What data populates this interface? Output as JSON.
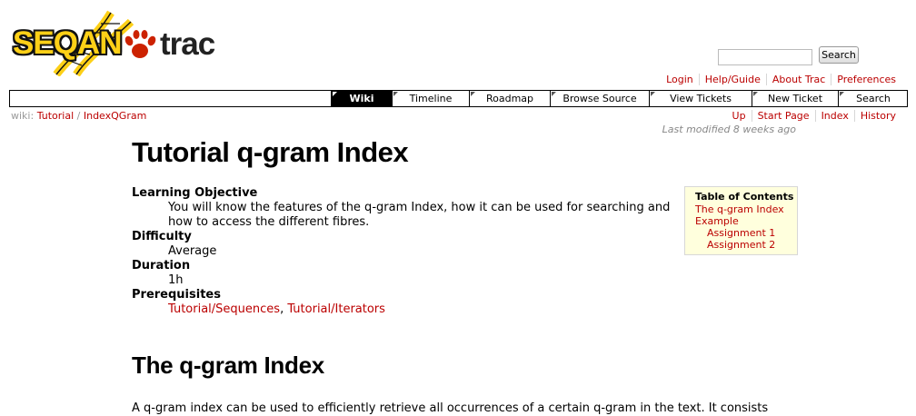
{
  "logo": {
    "seqan_text": "SEQAN",
    "trac_text": "trac"
  },
  "search": {
    "value": "",
    "button_label": "Search"
  },
  "metanav": [
    "Login",
    "Help/Guide",
    "About Trac",
    "Preferences"
  ],
  "mainnav": [
    "Wiki",
    "Timeline",
    "Roadmap",
    "Browse Source",
    "View Tickets",
    "New Ticket",
    "Search"
  ],
  "mainnav_active": "Wiki",
  "breadcrumb": {
    "prefix": "wiki:",
    "items": [
      "Tutorial",
      "IndexQGram"
    ],
    "separator": "/"
  },
  "ctxnav": [
    "Up",
    "Start Page",
    "Index",
    "History"
  ],
  "last_modified": "Last modified 8 weeks ago",
  "page": {
    "title": "Tutorial q-gram Index",
    "deflist": [
      {
        "term": "Learning Objective",
        "desc": "You will know the features of the q-gram Index, how it can be used for searching and how to access the different fibres."
      },
      {
        "term": "Difficulty",
        "desc": "Average"
      },
      {
        "term": "Duration",
        "desc": "1h"
      },
      {
        "term": "Prerequisites",
        "links": [
          "Tutorial/Sequences",
          "Tutorial/Iterators"
        ]
      }
    ],
    "toc": {
      "title": "Table of Contents",
      "items": [
        "The q-gram Index",
        "Example"
      ],
      "subitems": [
        "Assignment 1",
        "Assignment 2"
      ]
    },
    "section_heading": "The q-gram Index",
    "section_text": "A q-gram index can be used to efficiently retrieve all occurrences of a certain q-gram in the text. It consists"
  },
  "colors": {
    "link": "#bb0000",
    "logo_yellow": "#fdd017",
    "paw_red": "#cc2200",
    "toc_background": "#ffffdd"
  }
}
